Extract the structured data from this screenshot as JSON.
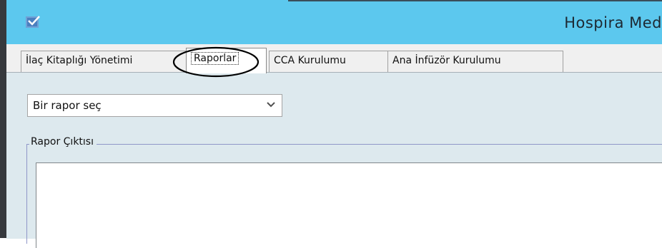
{
  "window": {
    "title": "Hospira Med",
    "icon": "app-logo-icon"
  },
  "tabs": [
    {
      "label": "İlaç Kitaplığı Yönetimi",
      "active": false
    },
    {
      "label": "Raporlar",
      "active": true
    },
    {
      "label": "CCA Kurulumu",
      "active": false
    },
    {
      "label": "Ana İnfüzör Kurulumu",
      "active": false
    }
  ],
  "report": {
    "select_value": "Bir rapor seç",
    "output_label": "Rapor Çıktısı"
  },
  "colors": {
    "titlebar": "#5cc8ee",
    "panel": "#dde9ee",
    "groupbox_border": "#8f96c8",
    "annotation": "#000000"
  }
}
